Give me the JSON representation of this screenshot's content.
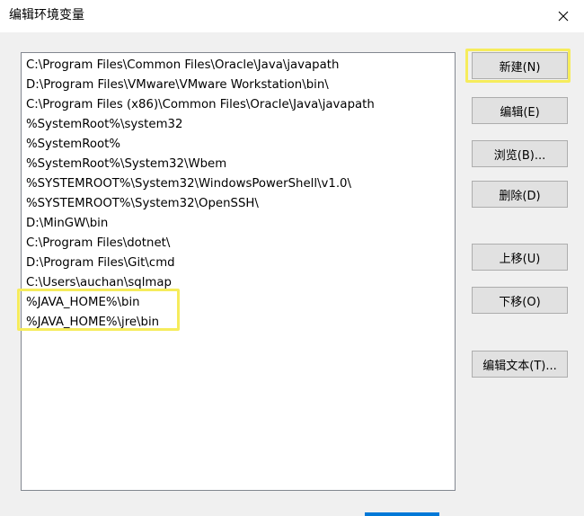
{
  "window": {
    "title": "编辑环境变量",
    "close_icon": "close-icon"
  },
  "paths": [
    "C:\\Program Files\\Common Files\\Oracle\\Java\\javapath",
    "D:\\Program Files\\VMware\\VMware Workstation\\bin\\",
    "C:\\Program Files (x86)\\Common Files\\Oracle\\Java\\javapath",
    "%SystemRoot%\\system32",
    "%SystemRoot%",
    "%SystemRoot%\\System32\\Wbem",
    "%SYSTEMROOT%\\System32\\WindowsPowerShell\\v1.0\\",
    "%SYSTEMROOT%\\System32\\OpenSSH\\",
    "D:\\MinGW\\bin",
    "C:\\Program Files\\dotnet\\",
    "D:\\Program Files\\Git\\cmd",
    "C:\\Users\\auchan\\sqlmap",
    "%JAVA_HOME%\\bin",
    "%JAVA_HOME%\\jre\\bin"
  ],
  "buttons": {
    "new": "新建(N)",
    "edit": "编辑(E)",
    "browse": "浏览(B)...",
    "delete": "删除(D)",
    "move_up": "上移(U)",
    "move_down": "下移(O)",
    "edit_text": "编辑文本(T)..."
  },
  "colors": {
    "highlight": "#f6ec5c",
    "accent": "#0078d7"
  }
}
